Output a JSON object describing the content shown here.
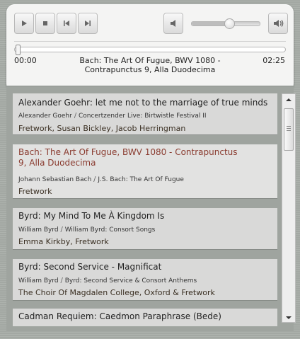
{
  "player": {
    "buttons": {
      "play": "play-icon",
      "stop": "stop-icon",
      "previous": "previous-icon",
      "next": "next-icon",
      "mute": "speaker-low-icon",
      "volume_max": "speaker-high-icon"
    },
    "volume_level": 0.55,
    "seek_position": 0.0,
    "time_elapsed": "00:00",
    "time_total": "02:25",
    "now_playing": "Bach: The Art Of Fugue, BWV 1080 - Contrapunctus 9, Alla Duodecima"
  },
  "playlist": {
    "items": [
      {
        "title": "Alexander Goehr: let me not to the marriage of true minds",
        "composer": "Alexander Goehr",
        "album": "Concertzender Live: Birtwistle Festival II",
        "artist": "Fretwork, Susan Bickley, Jacob Herringman",
        "selected": false
      },
      {
        "title": "Bach: The Art Of Fugue, BWV 1080 - Contrapunctus 9, Alla Duodecima",
        "composer": "Johann Sebastian Bach",
        "album": "J.S. Bach: The Art Of Fugue",
        "artist": "Fretwork",
        "selected": true
      },
      {
        "title": "Byrd: My Mind To Me À Kingdom Is",
        "composer": "William Byrd",
        "album": "William Byrd: Consort Songs",
        "artist": "Emma Kirkby, Fretwork",
        "selected": false
      },
      {
        "title": "Byrd: Second Service - Magnificat",
        "composer": "William Byrd",
        "album": "Byrd: Second Service & Consort Anthems",
        "artist": "The Choir Of Magdalen College, Oxford & Fretwork",
        "selected": false
      },
      {
        "title": "Cadman Requiem: Caedmon Paraphrase (Bede)",
        "composer": "",
        "album": "",
        "artist": "",
        "selected": false
      }
    ],
    "separator": "/"
  },
  "colors": {
    "background": "#a8ada8",
    "panel": "#f4f4f3",
    "selected_title": "#8a3b2f"
  }
}
